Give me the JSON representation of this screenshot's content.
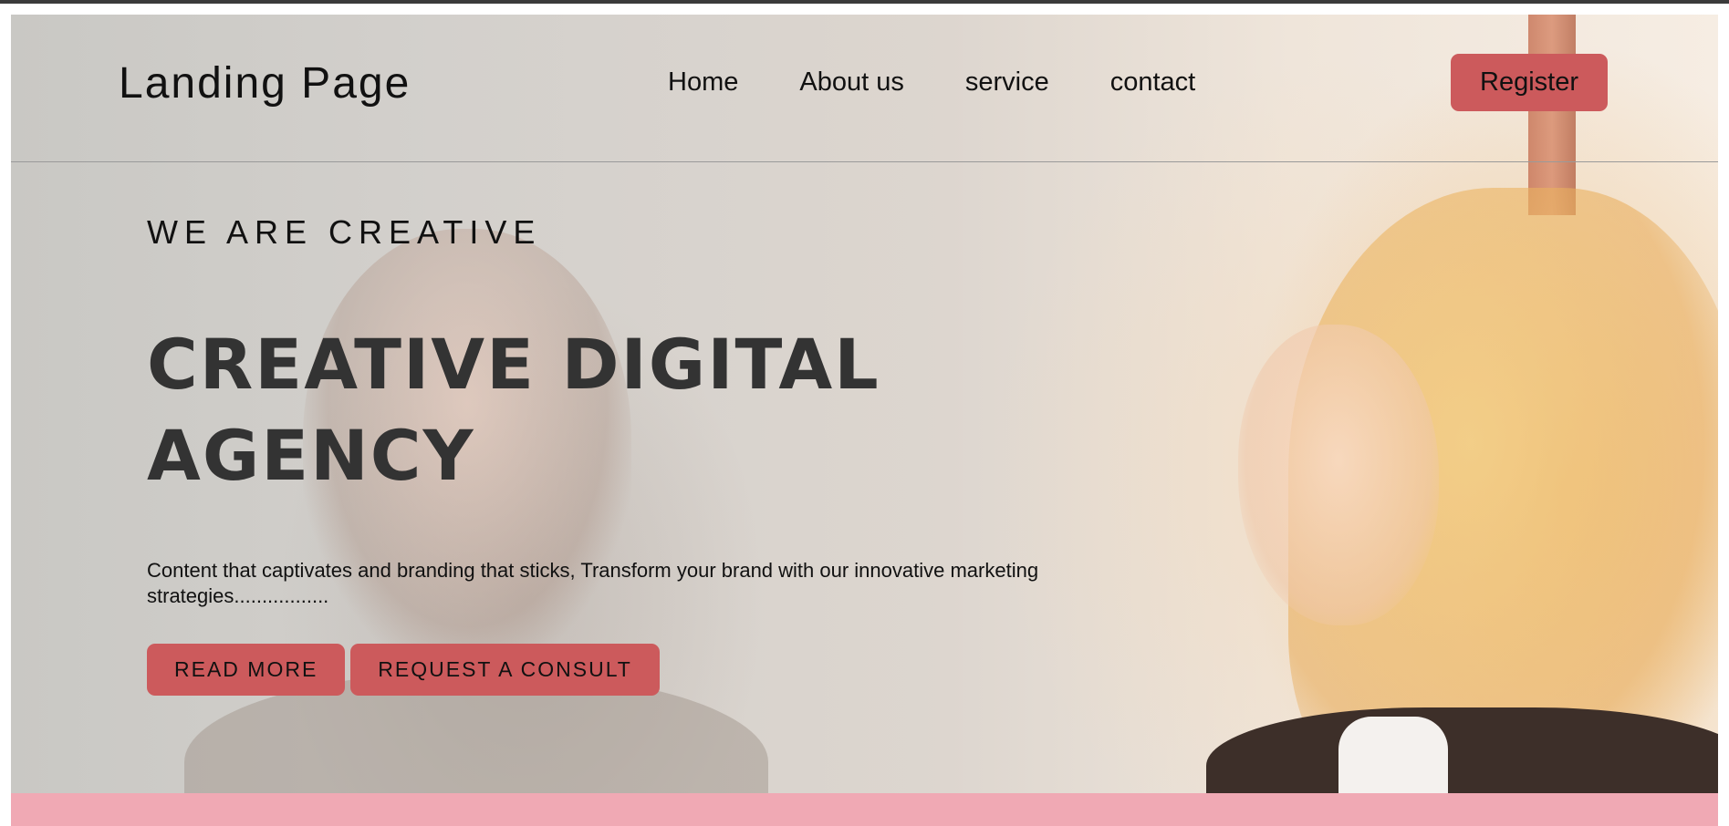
{
  "header": {
    "brand": "Landing Page",
    "nav": [
      "Home",
      "About us",
      "service",
      "contact"
    ],
    "register_label": "Register"
  },
  "hero": {
    "kicker": "WE ARE CREATIVE",
    "headline": "CREATIVE DIGITAL AGENCY",
    "lede": "Content that captivates and branding that sticks, Transform your brand with our innovative marketing strategies.................",
    "buttons": {
      "read_more": "READ MORE",
      "consult": "REQUEST A CONSULT"
    }
  },
  "colors": {
    "accent": "#cc5a5c",
    "band": "#f0a9b4",
    "headline": "#333333"
  }
}
